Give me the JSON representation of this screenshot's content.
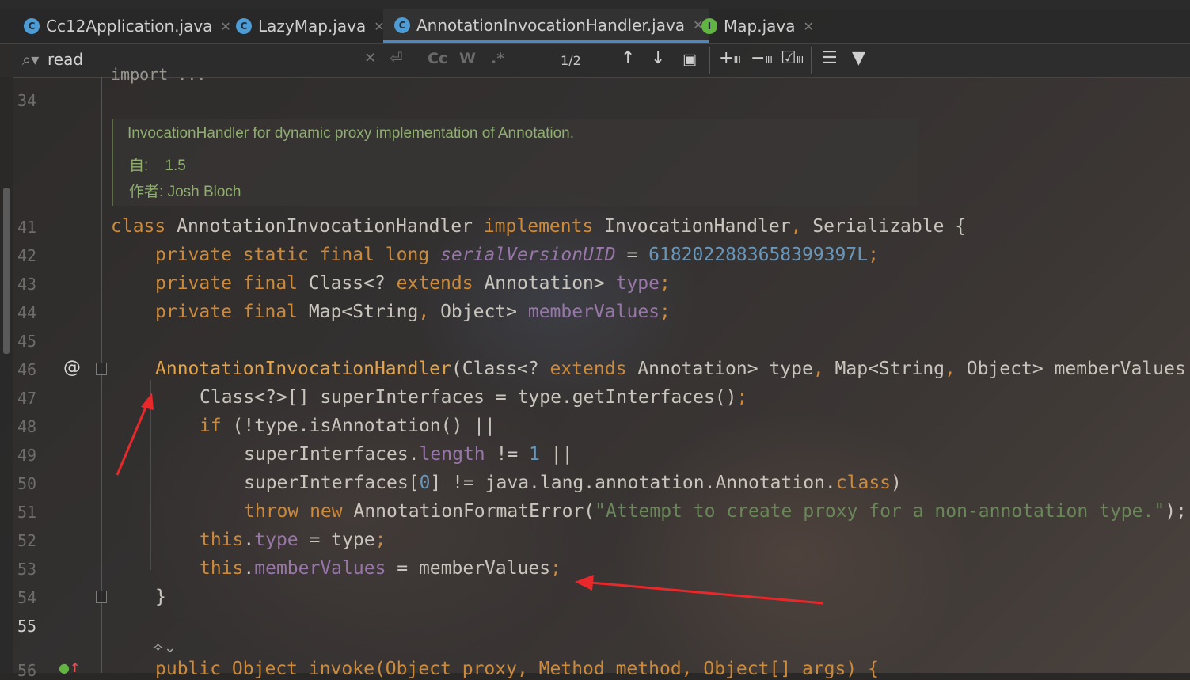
{
  "tabs": [
    {
      "label": "Cc12Application.java",
      "icon": "C",
      "color": "#4e9cd6",
      "active": false
    },
    {
      "label": "LazyMap.java",
      "icon": "C",
      "color": "#4e9cd6",
      "active": false
    },
    {
      "label": "AnnotationInvocationHandler.java",
      "icon": "C",
      "color": "#4e9cd6",
      "active": true
    },
    {
      "label": "Map.java",
      "icon": "I",
      "color": "#62b543",
      "active": false
    }
  ],
  "find": {
    "query": "read",
    "match_case": "Cc",
    "words": "W",
    "regex": ".*",
    "count": "1/2"
  },
  "doc": {
    "summary": "InvocationHandler for dynamic proxy implementation of Annotation.",
    "since_label": "自:",
    "since_value": "1.5",
    "author_label": "作者:",
    "author_value": "Josh Bloch"
  },
  "partial_top": "import ...",
  "line_numbers": [
    "34",
    "41",
    "42",
    "43",
    "44",
    "45",
    "46",
    "47",
    "48",
    "49",
    "50",
    "51",
    "52",
    "53",
    "54",
    "55",
    "56"
  ],
  "gutter_marker": "@",
  "code": {
    "l41": [
      [
        "k",
        "class "
      ],
      [
        "t",
        "AnnotationInvocationHandler "
      ],
      [
        "k",
        "implements "
      ],
      [
        "t",
        "InvocationHandler"
      ],
      [
        "k",
        ", "
      ],
      [
        "t",
        "Serializable {"
      ]
    ],
    "l42": [
      [
        "k",
        "private static final long "
      ],
      [
        "i",
        "serialVersionUID"
      ],
      [
        "t",
        " = "
      ],
      [
        "n",
        "6182022883658399397L"
      ],
      [
        "k",
        ";"
      ]
    ],
    "l43": [
      [
        "k",
        "private final "
      ],
      [
        "t",
        "Class<? "
      ],
      [
        "k",
        "extends "
      ],
      [
        "t",
        "Annotation> "
      ],
      [
        "p",
        "type"
      ],
      [
        "k",
        ";"
      ]
    ],
    "l44": [
      [
        "k",
        "private final "
      ],
      [
        "t",
        "Map<String"
      ],
      [
        "k",
        ", "
      ],
      [
        "t",
        "Object> "
      ],
      [
        "p",
        "memberValues"
      ],
      [
        "k",
        ";"
      ]
    ],
    "l46": [
      [
        "f",
        "AnnotationInvocationHandler"
      ],
      [
        "t",
        "(Class<? "
      ],
      [
        "k",
        "extends "
      ],
      [
        "t",
        "Annotation> type"
      ],
      [
        "k",
        ", "
      ],
      [
        "t",
        "Map<String"
      ],
      [
        "k",
        ", "
      ],
      [
        "t",
        "Object> memberValues"
      ]
    ],
    "l47": [
      [
        "t",
        "Class<?>[] superInterfaces = type.getInterfaces()"
      ],
      [
        "k",
        ";"
      ]
    ],
    "l48": [
      [
        "k",
        "if "
      ],
      [
        "t",
        "(!type.isAnnotation() ||"
      ]
    ],
    "l49": [
      [
        "t",
        "superInterfaces."
      ],
      [
        "p",
        "length"
      ],
      [
        "t",
        " != "
      ],
      [
        "n",
        "1"
      ],
      [
        "t",
        " ||"
      ]
    ],
    "l50": [
      [
        "t",
        "superInterfaces["
      ],
      [
        "n",
        "0"
      ],
      [
        "t",
        "] != java.lang.annotation.Annotation."
      ],
      [
        "k",
        "class"
      ],
      [
        "t",
        ")"
      ]
    ],
    "l51": [
      [
        "k",
        "throw new "
      ],
      [
        "t",
        "AnnotationFormatError("
      ],
      [
        "s",
        "\"Attempt to create proxy for a non-annotation type.\""
      ],
      [
        "t",
        ");"
      ]
    ],
    "l52": [
      [
        "k",
        "this"
      ],
      [
        "t",
        "."
      ],
      [
        "p",
        "type"
      ],
      [
        "t",
        " = type"
      ],
      [
        "k",
        ";"
      ]
    ],
    "l53": [
      [
        "k",
        "this"
      ],
      [
        "t",
        "."
      ],
      [
        "p",
        "memberValues"
      ],
      [
        "t",
        " = memberValues"
      ],
      [
        "k",
        ";"
      ]
    ],
    "l54": [
      [
        "t",
        "}"
      ]
    ]
  },
  "partial_bottom": "public Object invoke(Object proxy, Method method, Object[] args) {",
  "colors": {
    "keyword": "#cc8a3a",
    "field": "#9876aa",
    "number": "#6897bb",
    "string": "#6a8759",
    "annotation_arrow": "#e8282a"
  }
}
